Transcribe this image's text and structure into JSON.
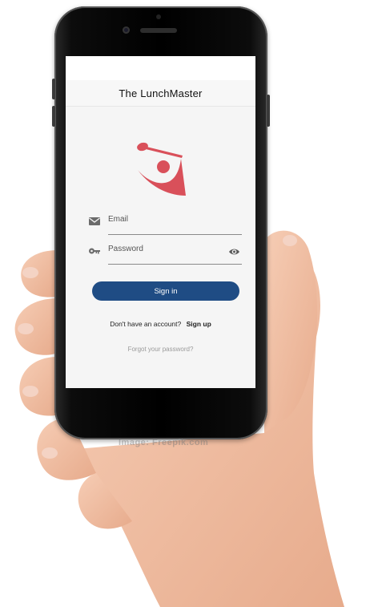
{
  "app": {
    "title": "The LunchMaster"
  },
  "form": {
    "email_label": "Email",
    "password_label": "Password",
    "signin_label": "Sign in",
    "signup_prompt": "Don't have an account?",
    "signup_link": "Sign up",
    "forgot_link": "Forgot your password?"
  },
  "watermark": "Image: Freepik.com",
  "icons": {
    "email": "mail-icon",
    "password": "key-icon",
    "visibility": "eye-icon",
    "logo": "chef-spoon-logo"
  },
  "colors": {
    "accent": "#1f4c84",
    "logo": "#d9505a"
  }
}
